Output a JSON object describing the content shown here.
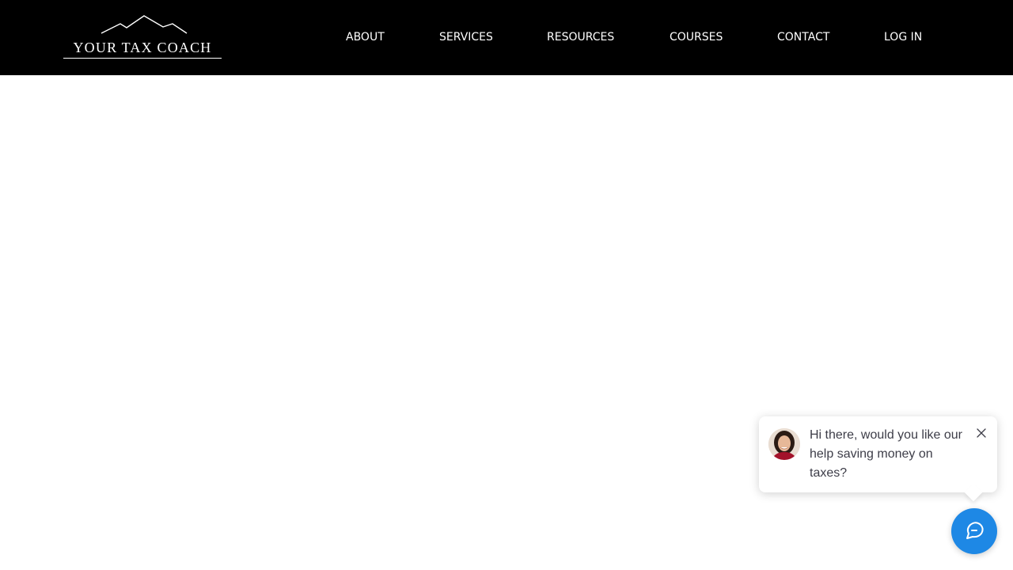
{
  "brand": {
    "logo_text": "YOUR TAX COACH",
    "logo_icon": "mountain-icon"
  },
  "nav": {
    "items": [
      {
        "label": "ABOUT"
      },
      {
        "label": "SERVICES"
      },
      {
        "label": "RESOURCES"
      },
      {
        "label": "COURSES"
      },
      {
        "label": "CONTACT"
      },
      {
        "label": "LOG IN"
      }
    ]
  },
  "chat": {
    "message": "Hi there, would you like our help saving money on taxes?",
    "close_icon": "close-icon",
    "launcher_icon": "chat-bubble-icon"
  },
  "colors": {
    "header_bg": "#000000",
    "header_text": "#ffffff",
    "chat_launcher": "#1e88e5",
    "chat_text": "#3d3d48"
  }
}
